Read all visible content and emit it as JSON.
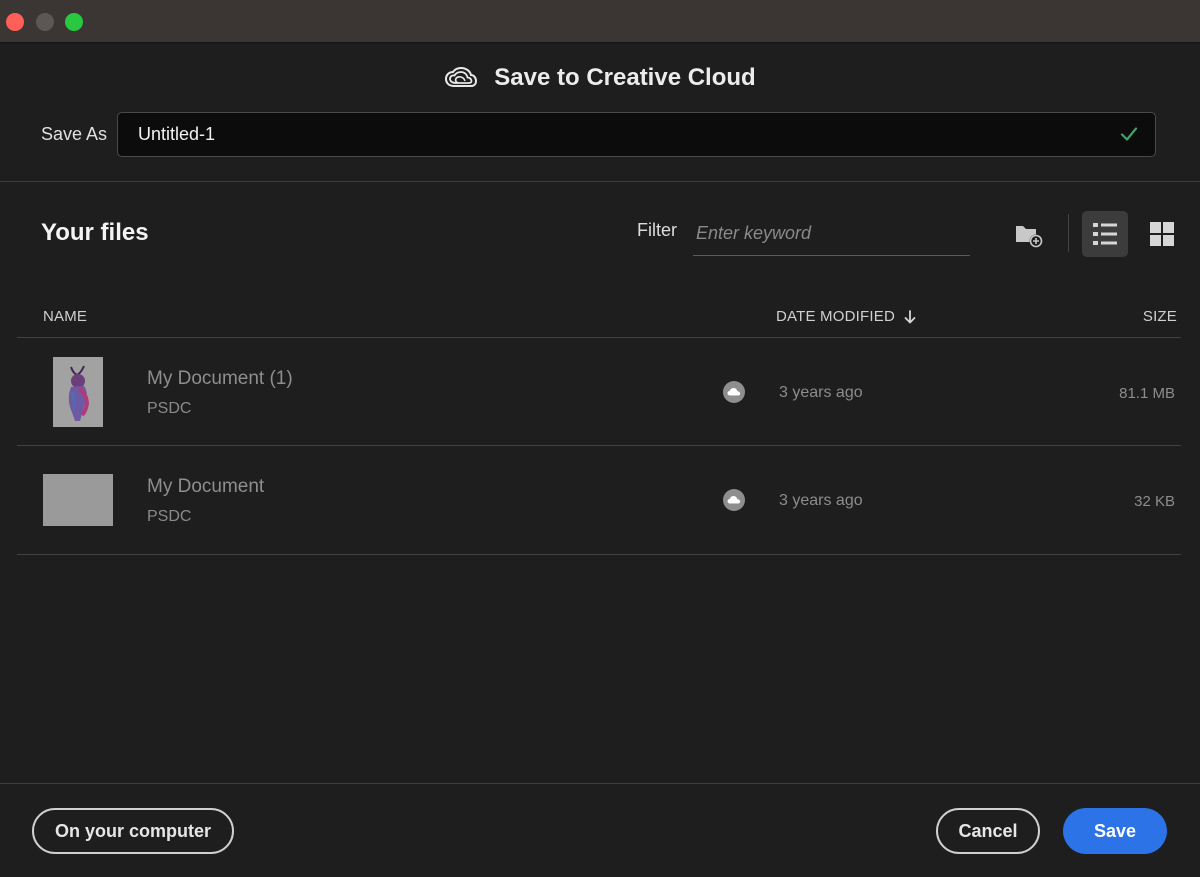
{
  "window": {
    "controls": [
      "close",
      "minimize",
      "maximize"
    ]
  },
  "dialog": {
    "title": "Save to Creative Cloud",
    "logo_icon": "creative-cloud-icon"
  },
  "save_as": {
    "label": "Save As",
    "value": "Untitled-1",
    "valid_icon": "checkmark-icon"
  },
  "files_section": {
    "heading": "Your files",
    "filter_label": "Filter",
    "filter_placeholder": "Enter keyword",
    "toolbar_icons": [
      "new-folder-icon",
      "list-view-icon",
      "grid-view-icon"
    ],
    "active_view": "list"
  },
  "table": {
    "columns": {
      "name": "NAME",
      "date": "DATE MODIFIED",
      "size": "SIZE"
    },
    "sort": {
      "column": "date",
      "direction": "descending"
    },
    "rows": [
      {
        "name": "My Document (1)",
        "type": "PSDC",
        "date": "3 years ago",
        "size": "81.1 MB",
        "thumbnail": "portrait-artwork"
      },
      {
        "name": "My Document",
        "type": "PSDC",
        "date": "3 years ago",
        "size": "32 KB",
        "thumbnail": "blank-gray"
      }
    ]
  },
  "footer": {
    "on_computer": "On your computer",
    "cancel": "Cancel",
    "save": "Save"
  },
  "colors": {
    "background": "#1e1e1e",
    "titlebar": "#3b3533",
    "accent_blue": "#2b73e6",
    "valid_green": "#3fa36a"
  }
}
